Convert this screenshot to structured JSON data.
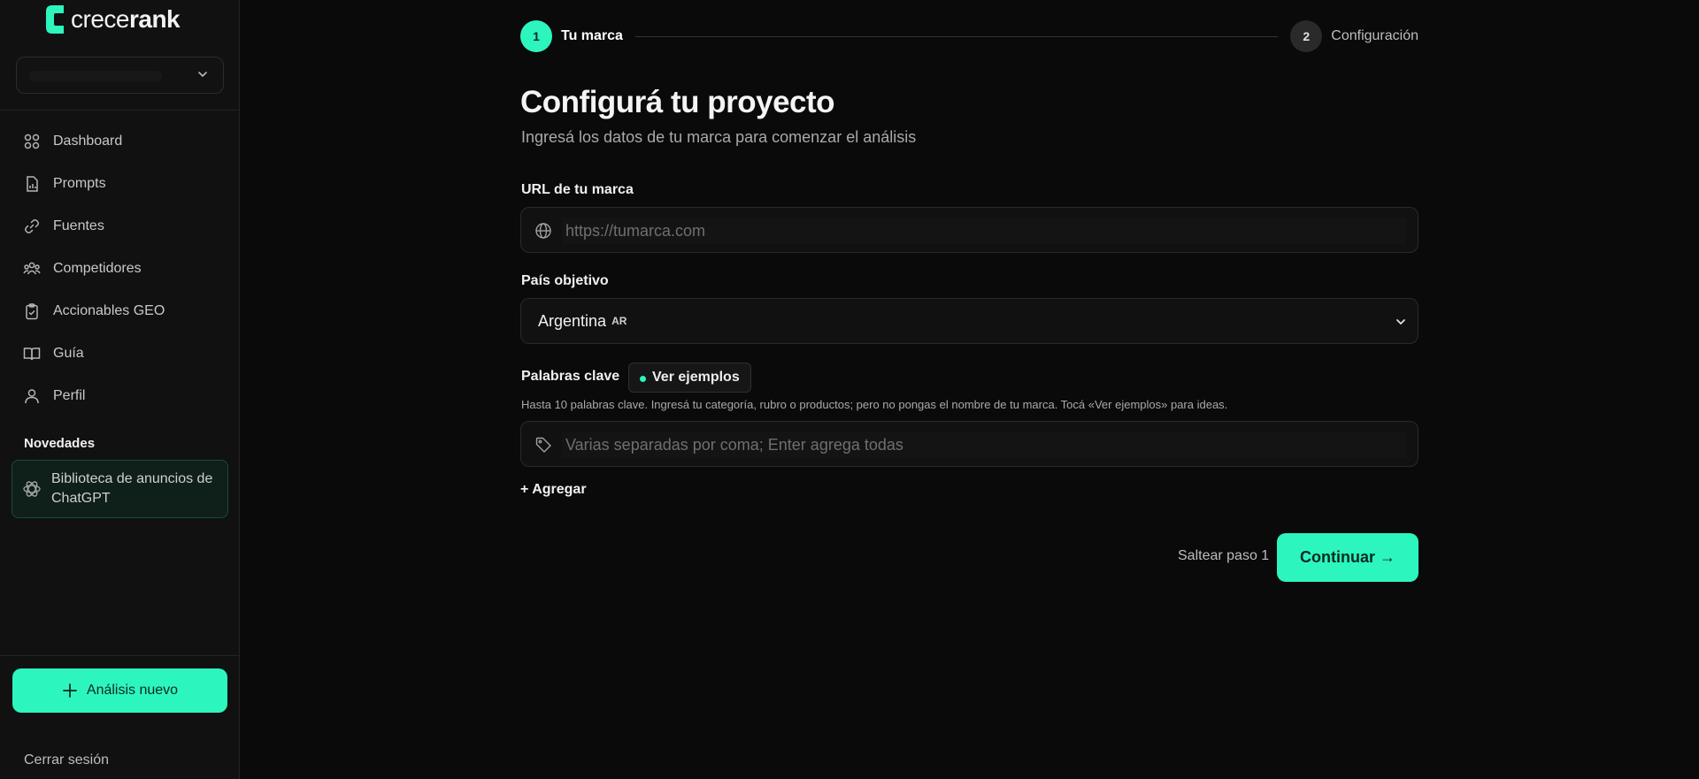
{
  "brand": {
    "name_light": "crece",
    "name_bold": "rank",
    "accent": "#2df5be"
  },
  "sidebar": {
    "items": [
      {
        "label": "Dashboard",
        "icon": "grid-icon"
      },
      {
        "label": "Prompts",
        "icon": "document-chart-icon"
      },
      {
        "label": "Fuentes",
        "icon": "link-icon"
      },
      {
        "label": "Competidores",
        "icon": "users-icon"
      },
      {
        "label": "Accionables GEO",
        "icon": "clipboard-check-icon"
      },
      {
        "label": "Guía",
        "icon": "book-icon"
      },
      {
        "label": "Perfil",
        "icon": "user-icon"
      }
    ],
    "news_label": "Novedades",
    "news_card": {
      "label": "Biblioteca de anuncios de ChatGPT",
      "icon": "openai-icon"
    },
    "new_analysis_label": "Análisis nuevo",
    "logout_label": "Cerrar sesión"
  },
  "stepper": {
    "steps": [
      {
        "number": "1",
        "label": "Tu marca",
        "state": "active"
      },
      {
        "number": "2",
        "label": "Configuración",
        "state": "inactive"
      }
    ]
  },
  "form": {
    "title": "Configurá tu proyecto",
    "subtitle": "Ingresá los datos de tu marca para comenzar el análisis",
    "url": {
      "label": "URL de tu marca",
      "placeholder": "https://tumarca.com",
      "value": ""
    },
    "country": {
      "label": "País objetivo",
      "value": "Argentina",
      "code": "AR"
    },
    "keywords": {
      "label": "Palabras clave",
      "examples_label": "Ver ejemplos",
      "helper": "Hasta 10 palabras clave. Ingresá tu categoría, rubro o productos; pero no pongas el nombre de tu marca. Tocá «Ver ejemplos» para ideas.",
      "placeholder": "Varias separadas por coma; Enter agrega todas",
      "value": ""
    },
    "add_label": "+ Agregar",
    "skip_label": "Saltear paso 1",
    "continue_label": "Continuar →"
  }
}
